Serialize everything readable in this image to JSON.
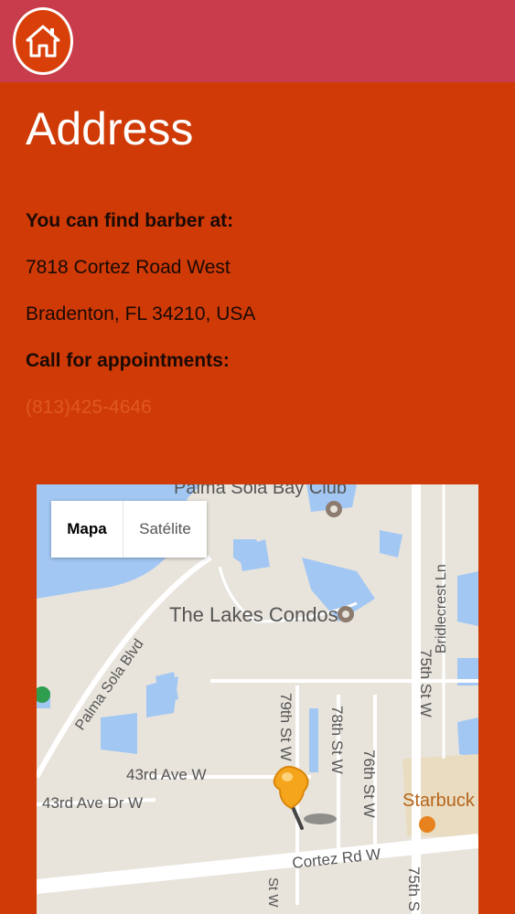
{
  "header": {
    "home_icon": "home-icon"
  },
  "page": {
    "title": "Address",
    "intro": "You can find barber at:",
    "address_line1": "7818 Cortez Road West",
    "address_line2": "Bradenton, FL 34210, USA",
    "appointments_label": "Call for appointments:",
    "phone": "(813)425-4646"
  },
  "map": {
    "map_tab": "Mapa",
    "satellite_tab": "Satélite",
    "labels": {
      "club": "Palma Sola Bay Club",
      "condos": "The Lakes Condos",
      "blvd": "Palma Sola Blvd",
      "st75": "75th St W",
      "bridlecrest": "Bridlecrest Ln",
      "st79": "79th St W",
      "st78": "78th St W",
      "st76": "76th St W",
      "ave43": "43rd Ave W",
      "ave43dr": "43rd Ave Dr W",
      "starbucks": "Starbuck",
      "cortez": "Cortez Rd W",
      "st75b": "75th S",
      "stw": "St W"
    }
  },
  "colors": {
    "background": "#cf3a06",
    "header": "#c83c4b",
    "title": "#ffffff",
    "phone": "#e0581f"
  }
}
